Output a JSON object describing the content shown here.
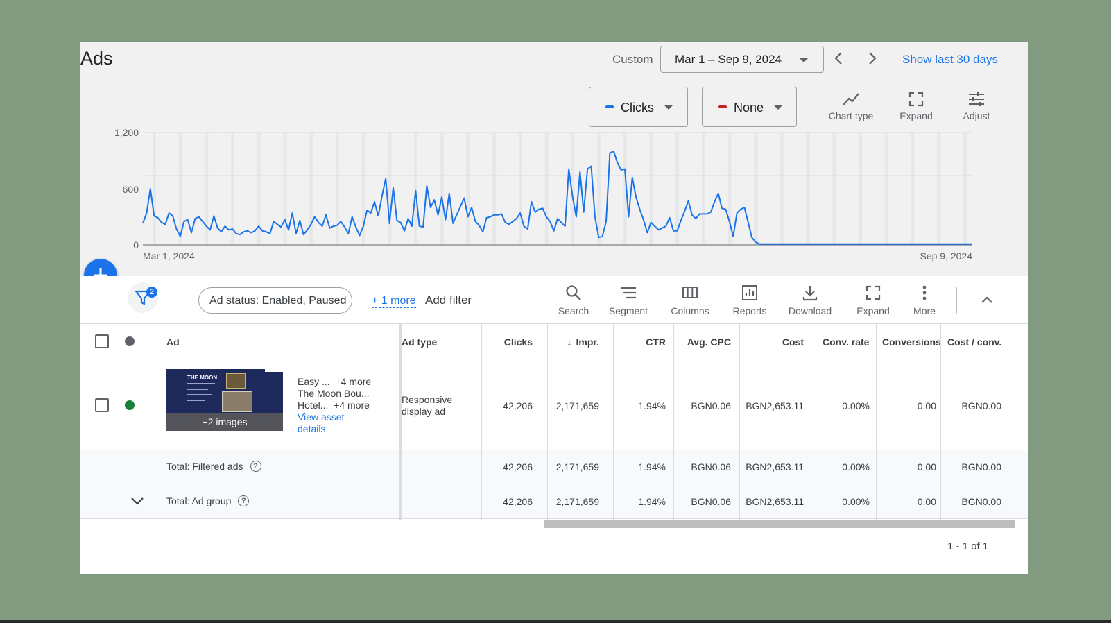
{
  "header": {
    "title": "Ads",
    "custom_label": "Custom",
    "date_range": "Mar 1 – Sep 9, 2024",
    "show_last": "Show last 30 days"
  },
  "chart_controls": {
    "metric1": {
      "label": "Clicks",
      "color": "#1a73e8"
    },
    "metric2": {
      "label": "None",
      "color": "#c5221f"
    },
    "tools": [
      {
        "label": "Chart type",
        "icon": "chart-type-icon"
      },
      {
        "label": "Expand",
        "icon": "expand-icon"
      },
      {
        "label": "Adjust",
        "icon": "adjust-icon"
      }
    ]
  },
  "chart_data": {
    "type": "line",
    "series": [
      {
        "color": "#1a73e8",
        "values": [
          230,
          340,
          600,
          310,
          290,
          240,
          220,
          340,
          310,
          170,
          90,
          250,
          270,
          130,
          280,
          300,
          250,
          200,
          160,
          310,
          180,
          140,
          200,
          160,
          170,
          120,
          110,
          140,
          150,
          130,
          150,
          200,
          150,
          140,
          120,
          250,
          220,
          190,
          270,
          160,
          340,
          120,
          260,
          110,
          160,
          220,
          300,
          240,
          200,
          320,
          180,
          200,
          210,
          250,
          190,
          120,
          300,
          190,
          100,
          200,
          370,
          340,
          460,
          310,
          520,
          710,
          230,
          610,
          260,
          240,
          150,
          280,
          200,
          580,
          200,
          190,
          630,
          400,
          480,
          320,
          510,
          270,
          550,
          230,
          320,
          410,
          500,
          300,
          400,
          250,
          210,
          140,
          290,
          300,
          320,
          320,
          330,
          240,
          220,
          250,
          280,
          340,
          200,
          170,
          460,
          350,
          380,
          390,
          300,
          250,
          150,
          280,
          240,
          200,
          810,
          520,
          300,
          780,
          350,
          810,
          840,
          300,
          80,
          90,
          250,
          980,
          1000,
          880,
          800,
          810,
          300,
          720,
          510,
          380,
          270,
          130,
          240,
          200,
          160,
          180,
          200,
          290,
          150,
          150,
          260,
          360,
          470,
          320,
          280,
          330,
          330,
          330,
          350,
          460,
          550,
          390,
          380,
          250,
          90,
          340,
          380,
          400,
          240,
          80,
          30,
          10,
          10,
          10,
          10,
          10,
          10,
          10,
          10,
          10,
          10,
          10,
          10,
          10,
          10,
          10,
          10,
          10,
          10,
          10,
          10,
          10,
          10,
          10,
          10,
          10,
          10,
          10,
          10,
          10,
          10,
          10,
          10,
          10,
          10,
          10,
          10,
          10,
          10,
          10,
          10,
          10,
          10,
          10,
          10,
          10,
          10,
          10,
          10,
          10,
          10,
          10,
          10,
          10,
          10,
          10,
          10,
          10,
          10
        ]
      }
    ],
    "x_start": "Mar 1, 2024",
    "x_end": "Sep 9, 2024",
    "y_ticks": [
      "1,200",
      "600",
      "0"
    ],
    "ylim": [
      0,
      1200
    ],
    "grid": true
  },
  "filters": {
    "count": "2",
    "chip": "Ad status: Enabled, Paused",
    "more": "+ 1 more",
    "add": "Add filter"
  },
  "toolbar": [
    {
      "label": "Search",
      "icon": "search-icon"
    },
    {
      "label": "Segment",
      "icon": "segment-icon"
    },
    {
      "label": "Columns",
      "icon": "columns-icon"
    },
    {
      "label": "Reports",
      "icon": "reports-icon"
    },
    {
      "label": "Download",
      "icon": "download-icon"
    },
    {
      "label": "Expand",
      "icon": "expand-icon"
    },
    {
      "label": "More",
      "icon": "more-vert-icon"
    }
  ],
  "table": {
    "columns": [
      "Ad",
      "Ad type",
      "Clicks",
      "Impr.",
      "CTR",
      "Avg. CPC",
      "Cost",
      "Conv. rate",
      "Conversions",
      "Cost / conv."
    ],
    "ad_row": {
      "line1": "Easy ...",
      "line1_more": "+4 more",
      "line2": "The Moon Bou...",
      "line3": "Hotel...",
      "line3_more": "+4 more",
      "view_asset": "View asset",
      "details": "details",
      "images_caption": "+2 images",
      "thumb_title": "THE MOON",
      "ad_type_l1": "Responsive",
      "ad_type_l2": "display ad",
      "values": [
        "42,206",
        "2,171,659",
        "1.94%",
        "BGN0.06",
        "BGN2,653.11",
        "0.00%",
        "0.00",
        "BGN0.00"
      ],
      "status_color": "#188038"
    },
    "total_filtered": {
      "label": "Total: Filtered ads",
      "values": [
        "42,206",
        "2,171,659",
        "1.94%",
        "BGN0.06",
        "BGN2,653.11",
        "0.00%",
        "0.00",
        "BGN0.00"
      ]
    },
    "total_group": {
      "label": "Total: Ad group",
      "values": [
        "42,206",
        "2,171,659",
        "1.94%",
        "BGN0.06",
        "BGN2,653.11",
        "0.00%",
        "0.00",
        "BGN0.00"
      ]
    }
  },
  "pagination": "1 - 1 of 1"
}
